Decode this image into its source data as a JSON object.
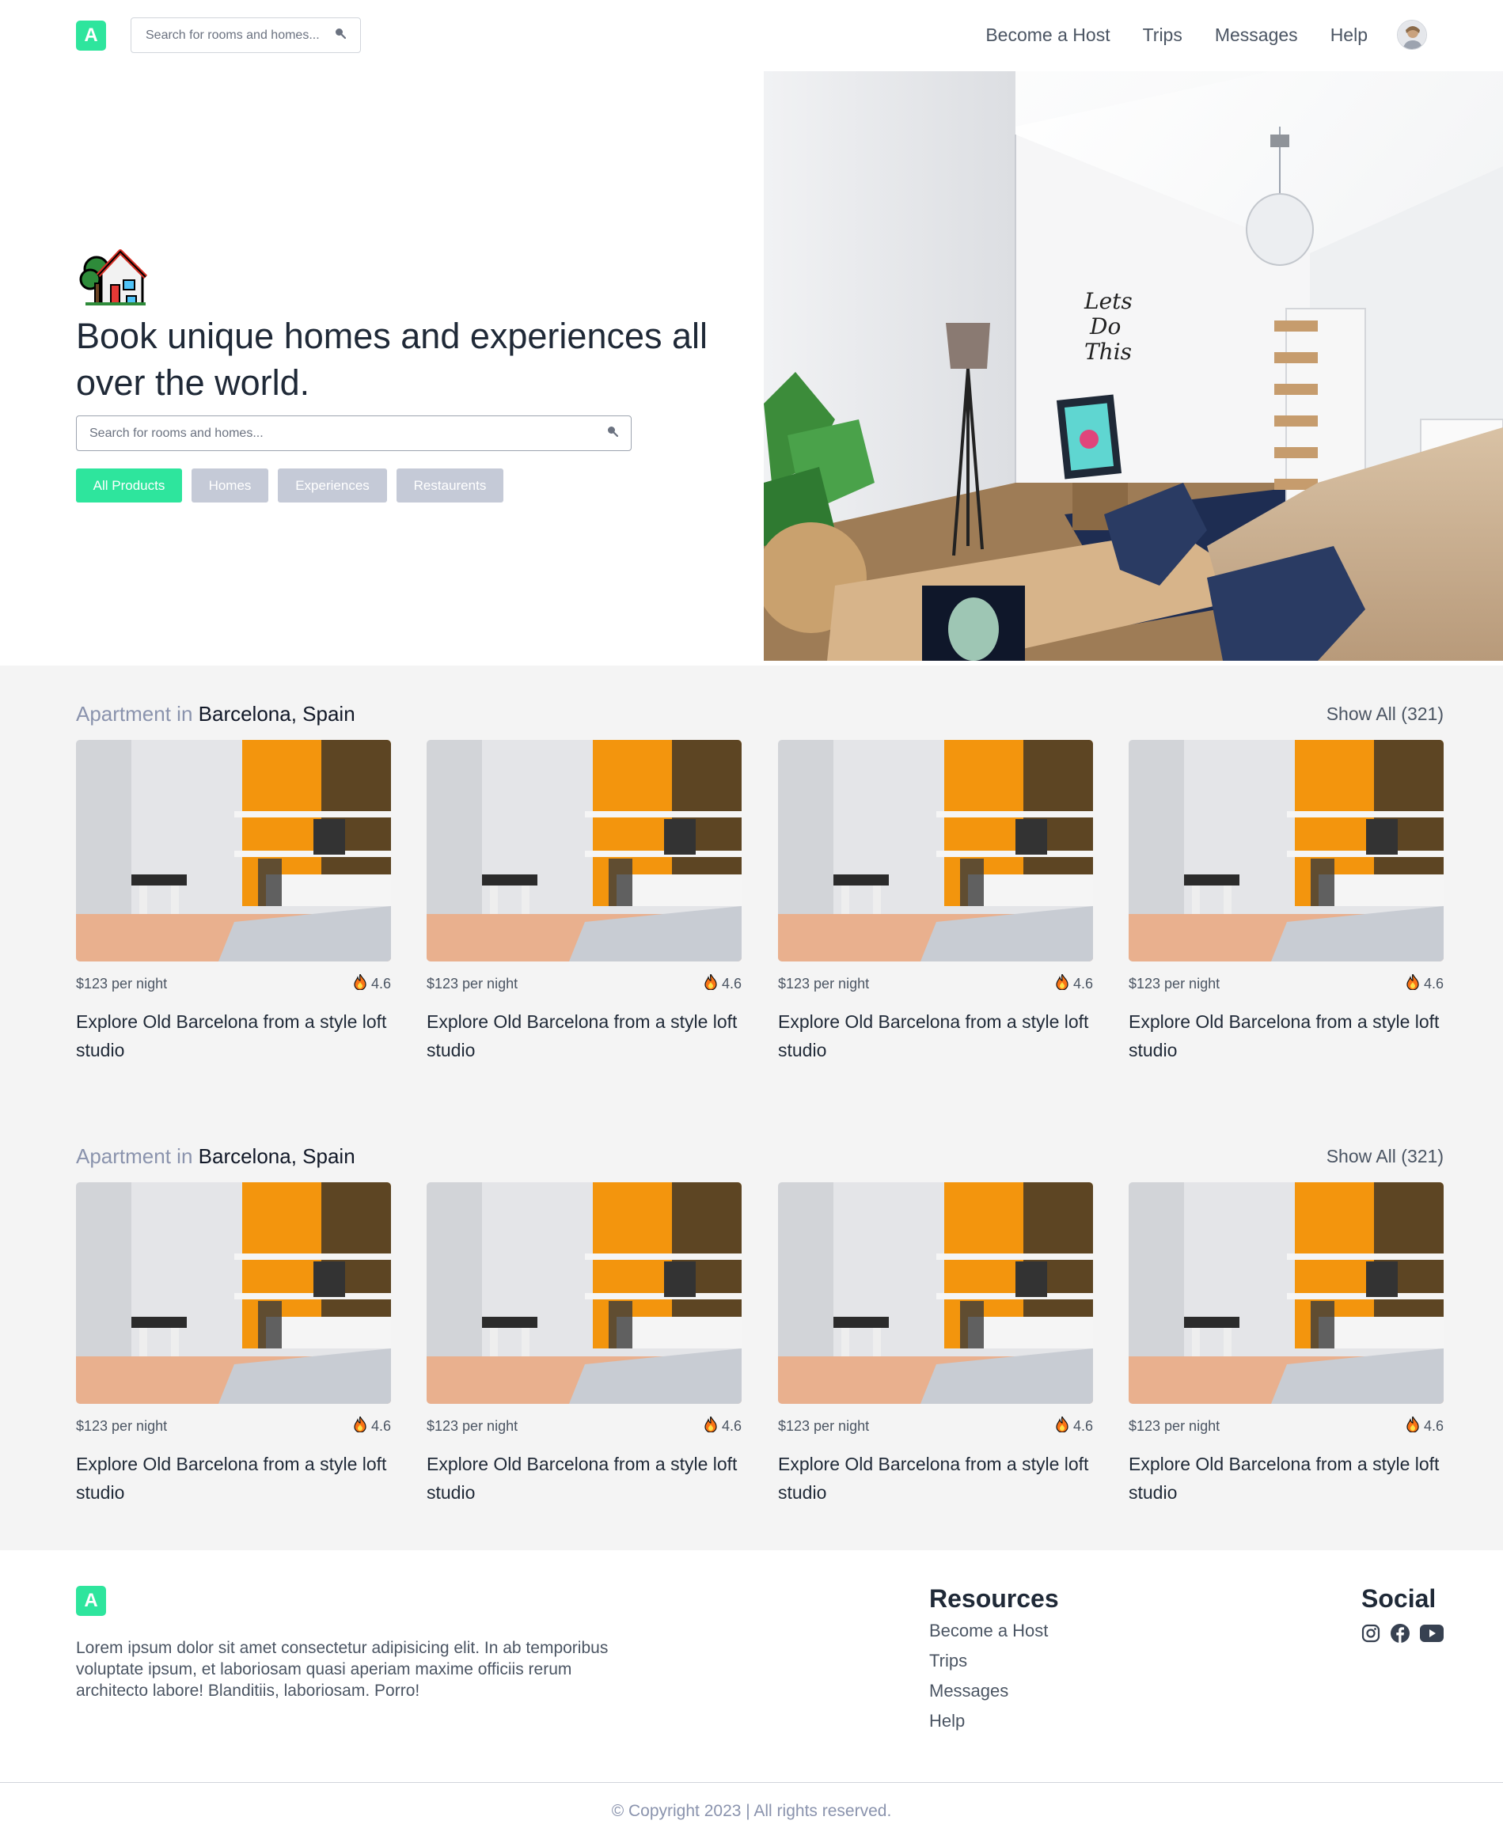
{
  "colors": {
    "accent": "#2ee59d",
    "chip_inactive": "#c5cad7",
    "section_bg": "#f4f4f4",
    "muted_text": "#8a93ad"
  },
  "header": {
    "logo_letter": "A",
    "search_placeholder": "Search for rooms and homes...",
    "nav": [
      "Become a Host",
      "Trips",
      "Messages",
      "Help"
    ]
  },
  "hero": {
    "icon": "house-with-tree-icon",
    "title": "Book unique homes and experiences all over the world.",
    "search_placeholder": "Search for rooms and homes...",
    "filters": [
      "All Products",
      "Homes",
      "Experiences",
      "Restaurents"
    ],
    "active_filter": "All Products"
  },
  "sections": [
    {
      "type_label": "Apartment in",
      "location": "Barcelona, Spain",
      "show_all": "Show All (321)",
      "cards": [
        {
          "price": "$123 per night",
          "rating": "4.6",
          "title": "Explore Old Barcelona from a style loft studio"
        },
        {
          "price": "$123 per night",
          "rating": "4.6",
          "title": "Explore Old Barcelona from a style loft studio"
        },
        {
          "price": "$123 per night",
          "rating": "4.6",
          "title": "Explore Old Barcelona from a style loft studio"
        },
        {
          "price": "$123 per night",
          "rating": "4.6",
          "title": "Explore Old Barcelona from a style loft studio"
        }
      ]
    },
    {
      "type_label": "Apartment in",
      "location": "Barcelona, Spain",
      "show_all": "Show All (321)",
      "cards": [
        {
          "price": "$123 per night",
          "rating": "4.6",
          "title": "Explore Old Barcelona from a style loft studio"
        },
        {
          "price": "$123 per night",
          "rating": "4.6",
          "title": "Explore Old Barcelona from a style loft studio"
        },
        {
          "price": "$123 per night",
          "rating": "4.6",
          "title": "Explore Old Barcelona from a style loft studio"
        },
        {
          "price": "$123 per night",
          "rating": "4.6",
          "title": "Explore Old Barcelona from a style loft studio"
        }
      ]
    }
  ],
  "footer": {
    "logo_letter": "A",
    "about": "Lorem ipsum dolor sit amet consectetur adipisicing elit. In ab temporibus voluptate ipsum, et laboriosam quasi aperiam maxime officiis rerum architecto labore! Blanditiis, laboriosam. Porro!",
    "resources_heading": "Resources",
    "resources": [
      "Become a Host",
      "Trips",
      "Messages",
      "Help"
    ],
    "social_heading": "Social",
    "social_icons": [
      "instagram-icon",
      "facebook-icon",
      "youtube-icon"
    ],
    "copyright": "© Copyright 2023 | All rights reserved."
  }
}
